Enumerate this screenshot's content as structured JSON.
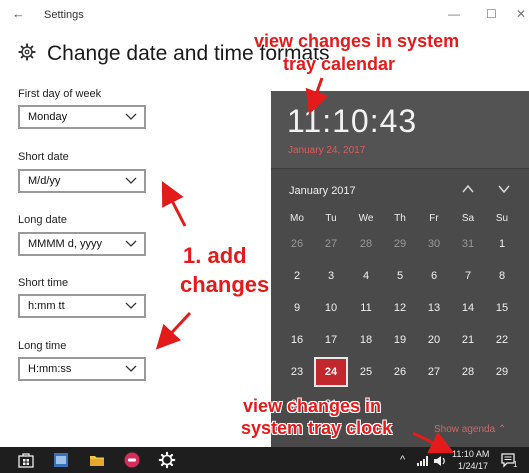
{
  "window": {
    "title": "Settings",
    "back": "←",
    "minimize": "—",
    "maximize": "☐",
    "close": "✕"
  },
  "page": {
    "title": "Change date and time formats"
  },
  "fields": [
    {
      "label": "First day of week",
      "value": "Monday"
    },
    {
      "label": "Short date",
      "value": "M/d/yy"
    },
    {
      "label": "Long date",
      "value": "MMMM d, yyyy"
    },
    {
      "label": "Short time",
      "value": "h:mm tt"
    },
    {
      "label": "Long time",
      "value": "H:mm:ss"
    }
  ],
  "calendar": {
    "time": "11:10:43",
    "date": "January 24, 2017",
    "month": "January 2017",
    "weekdays": [
      "Mo",
      "Tu",
      "We",
      "Th",
      "Fr",
      "Sa",
      "Su"
    ],
    "weeks": [
      [
        "26",
        "27",
        "28",
        "29",
        "30",
        "31",
        "1"
      ],
      [
        "2",
        "3",
        "4",
        "5",
        "6",
        "7",
        "8"
      ],
      [
        "9",
        "10",
        "11",
        "12",
        "13",
        "14",
        "15"
      ],
      [
        "16",
        "17",
        "18",
        "19",
        "20",
        "21",
        "22"
      ],
      [
        "23",
        "24",
        "25",
        "26",
        "27",
        "28",
        "29"
      ],
      [
        "30",
        "31"
      ]
    ],
    "today": "24",
    "agenda_label": "Show agenda",
    "agenda_arrow": "⌃"
  },
  "taskbar": {
    "tray_time": "11:10 AM",
    "tray_date": "1/24/17",
    "tray_chevron": "^",
    "notification_count": "1",
    "icons": [
      "store-icon",
      "photos-icon",
      "file-explorer-icon",
      "media-app-icon",
      "settings-icon"
    ]
  },
  "annotations": {
    "calendar_line1": "view changes in system",
    "calendar_line2": "tray calendar",
    "changes_line1": "1. add",
    "changes_line2": "changes",
    "clock_line1": "view changes in",
    "clock_line2": "system tray clock"
  },
  "colors": {
    "annotation": "#e31b1b",
    "today_highlight": "#c1272d",
    "flyout_bg": "#4a4a4a",
    "date_accent": "#e05a5a"
  }
}
